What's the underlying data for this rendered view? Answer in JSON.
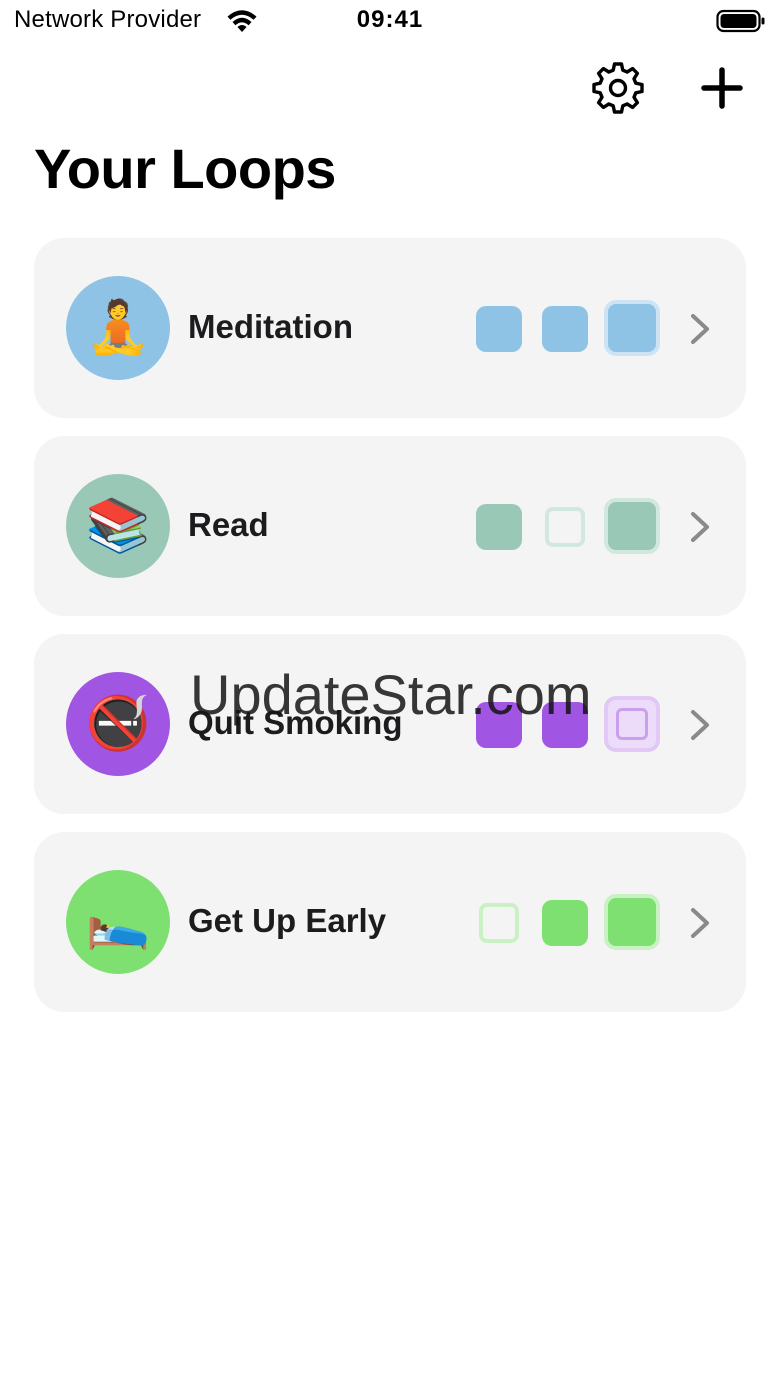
{
  "status_bar": {
    "carrier": "Network Provider",
    "time": "09:41",
    "wifi_icon": "wifi-icon",
    "battery_icon": "battery-full-icon"
  },
  "toolbar": {
    "settings_icon": "gear-icon",
    "add_icon": "plus-icon"
  },
  "page": {
    "title": "Your Loops"
  },
  "loops": [
    {
      "name": "Meditation",
      "emoji": "🧘",
      "color": "#8ec3e6",
      "light_color": "#cde3f3",
      "days": [
        "done",
        "done",
        "done"
      ]
    },
    {
      "name": "Read",
      "emoji": "📚",
      "color": "#9ac8b7",
      "light_color": "#d2e7de",
      "days": [
        "done",
        "empty",
        "done"
      ]
    },
    {
      "name": "Quit Smoking",
      "emoji": "🚭",
      "color": "#a155e3",
      "light_color": "#e1c8f5",
      "days": [
        "done",
        "done",
        "empty"
      ]
    },
    {
      "name": "Get Up Early",
      "emoji": "🛌",
      "color": "#7ee070",
      "light_color": "#c9f1c3",
      "days": [
        "empty",
        "done",
        "done"
      ]
    }
  ],
  "watermark": "UpdateStar.com"
}
